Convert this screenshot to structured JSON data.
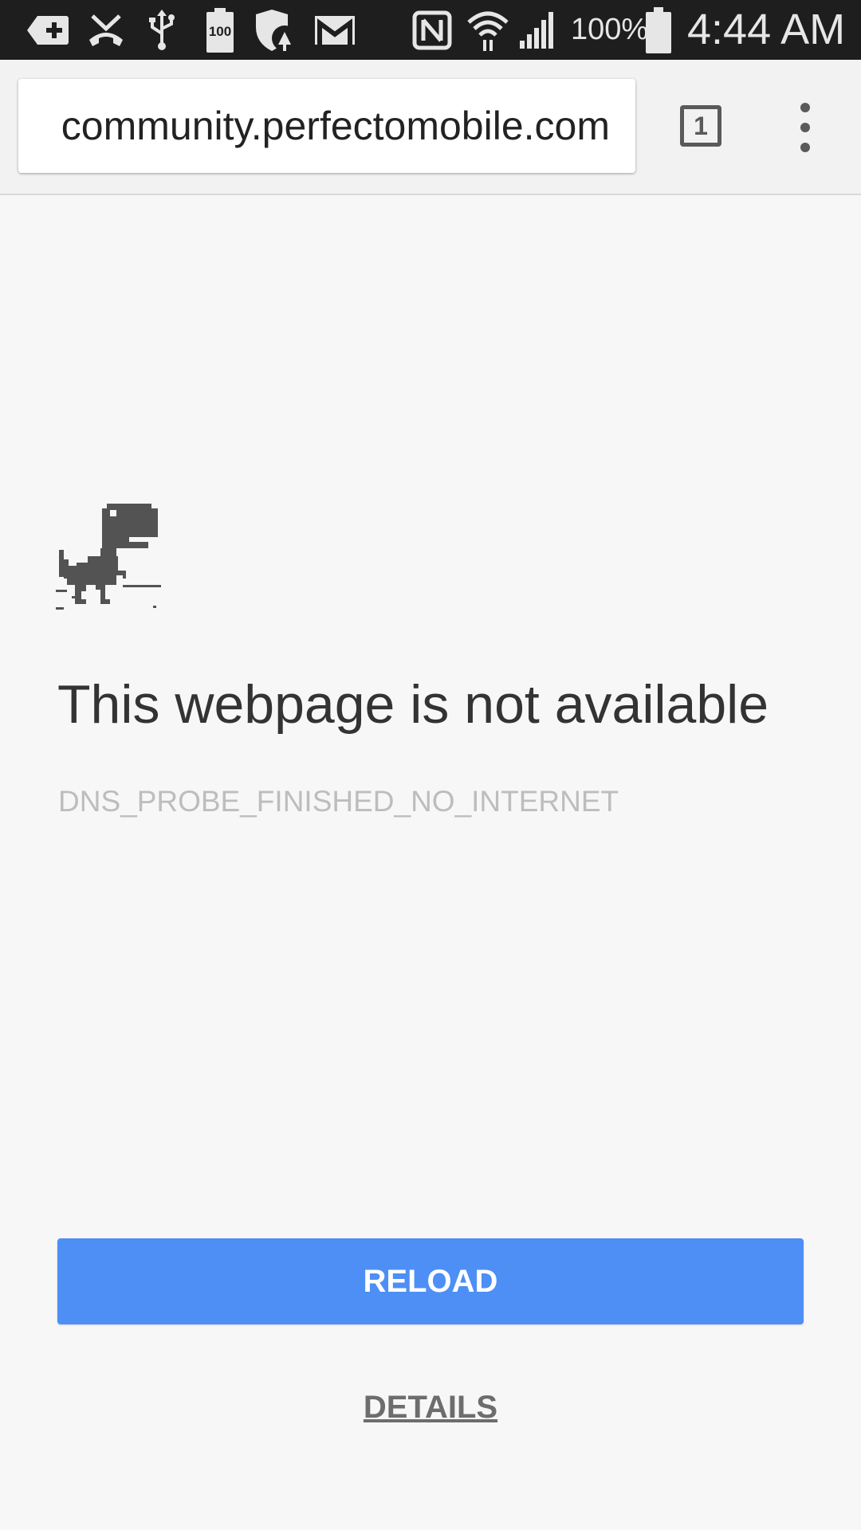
{
  "status_bar": {
    "icons": [
      "download-add-icon",
      "missed-call-icon",
      "usb-icon",
      "battery-100-icon",
      "shield-update-icon",
      "gmail-icon",
      "nfc-icon",
      "wifi-icon",
      "signal-icon",
      "battery-icon"
    ],
    "battery_percent": "100%",
    "time": "4:44 AM",
    "battery_chip_label": "100"
  },
  "toolbar": {
    "url": "community.perfectomobile.com",
    "tab_count": "1",
    "menu_icon": "overflow-menu-icon"
  },
  "error_page": {
    "icon": "dinosaur-icon",
    "title": "This webpage is not available",
    "error_code": "DNS_PROBE_FINISHED_NO_INTERNET",
    "reload_label": "RELOAD",
    "details_label": "DETAILS"
  },
  "colors": {
    "status_bar_bg": "#1e1e1e",
    "toolbar_bg": "#f2f2f2",
    "page_bg": "#f7f7f7",
    "reload_button": "#4d8ff5",
    "dino": "#535353"
  }
}
